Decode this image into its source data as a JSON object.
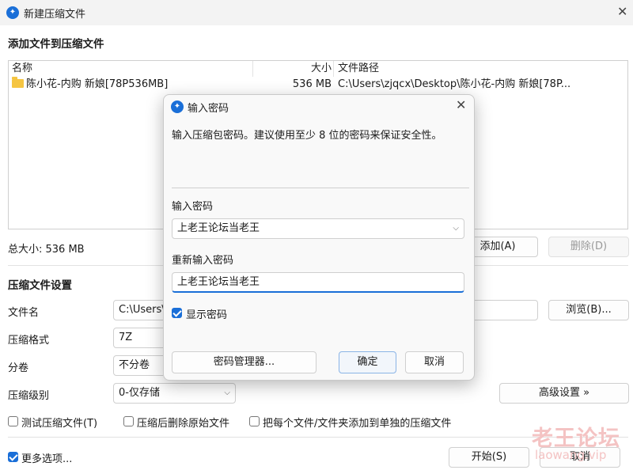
{
  "window": {
    "title": "新建压缩文件"
  },
  "files_section": {
    "title": "添加文件到压缩文件",
    "columns": {
      "name": "名称",
      "size": "大小",
      "path": "文件路径"
    },
    "rows": [
      {
        "name": "陈小花-内购 新娘[78P536MB]",
        "size": "536 MB",
        "path": "C:\\Users\\zjqcx\\Desktop\\陈小花-内购 新娘[78P..."
      }
    ],
    "total_size": "总大小: 536 MB",
    "add_button": "添加(A)",
    "delete_button": "删除(D)"
  },
  "settings": {
    "title": "压缩文件设置",
    "filename_label": "文件名",
    "filename_value": "C:\\Users\\",
    "browse_button": "浏览(B)...",
    "format_label": "压缩格式",
    "format_value": "7Z",
    "volume_label": "分卷",
    "volume_value": "不分卷",
    "level_label": "压缩级别",
    "level_value": "0-仅存储",
    "advanced_button": "高级设置 »",
    "test_checkbox": "测试压缩文件(T)",
    "delete_after_checkbox": "压缩后删除原始文件",
    "separate_checkbox": "把每个文件/文件夹添加到单独的压缩文件"
  },
  "footer": {
    "more_options": "更多选项...",
    "start_button": "开始(S)",
    "cancel_button": "取消"
  },
  "dialog": {
    "title": "输入密码",
    "description": "输入压缩包密码。建议使用至少 8 位的密码来保证安全性。",
    "password_label": "输入密码",
    "password_value": "上老王论坛当老王",
    "confirm_label": "重新输入密码",
    "confirm_value": "上老王论坛当老王",
    "show_password": "显示密码",
    "manager_button": "密码管理器...",
    "ok_button": "确定",
    "cancel_button": "取消"
  },
  "watermark": {
    "line1": "老王论坛",
    "line2": "laowang.vip"
  },
  "colors": {
    "accent": "#1a6fd8",
    "folder": "#f5c542",
    "watermark": "#f4c3c3"
  }
}
